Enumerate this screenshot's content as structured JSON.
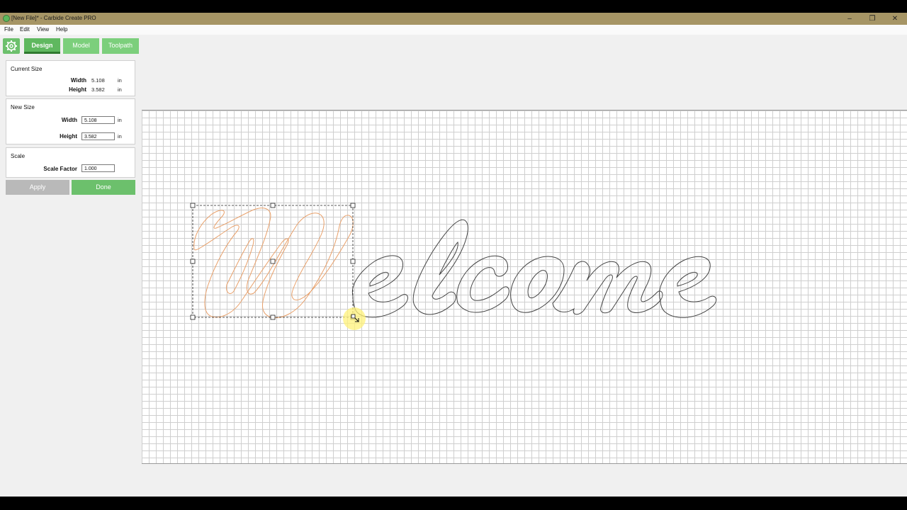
{
  "window": {
    "title": "[New File]* - Carbide Create PRO",
    "minimize": "–",
    "maximize": "❐",
    "close": "✕"
  },
  "menu": [
    "File",
    "Edit",
    "View",
    "Help"
  ],
  "tabs": [
    {
      "label": "Design",
      "active": true
    },
    {
      "label": "Model",
      "active": false
    },
    {
      "label": "Toolpath",
      "active": false
    }
  ],
  "current_size": {
    "title": "Current Size",
    "width_label": "Width",
    "width_value": "5.108",
    "height_label": "Height",
    "height_value": "3.582",
    "unit": "in"
  },
  "new_size": {
    "title": "New Size",
    "width_label": "Width",
    "width_value": "5.108",
    "height_label": "Height",
    "height_value": "3.582",
    "unit": "in"
  },
  "scale": {
    "title": "Scale",
    "factor_label": "Scale Factor",
    "factor_value": "1.000"
  },
  "buttons": {
    "apply": "Apply",
    "done": "Done"
  },
  "colors": {
    "accent_green": "#5fb85f",
    "selected_path": "#e8a06a",
    "path": "#333333",
    "cursor_highlight": "#fff27a"
  },
  "icons": {
    "settings": "gear-icon",
    "app": "carbide-logo-icon"
  }
}
